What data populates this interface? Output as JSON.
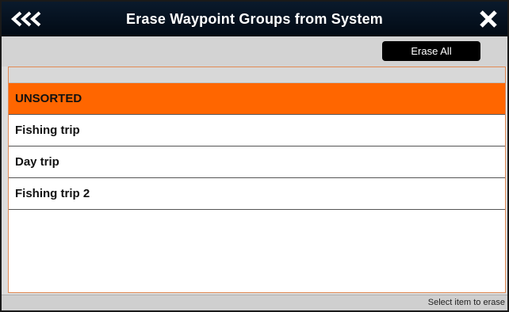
{
  "window": {
    "title": "Erase Waypoint Groups from System"
  },
  "titlebar": {
    "back_icon": "triple-chevron-left-icon",
    "close_icon": "close-icon"
  },
  "toolbar": {
    "erase_all_label": "Erase All"
  },
  "list": {
    "items": [
      {
        "label": "UNSORTED",
        "selected": true
      },
      {
        "label": "Fishing trip",
        "selected": false
      },
      {
        "label": "Day trip",
        "selected": false
      },
      {
        "label": "Fishing trip 2",
        "selected": false
      }
    ]
  },
  "status": {
    "text": "Select item to erase"
  },
  "colors": {
    "selected_row": "#ff6600",
    "titlebar": "#06121f",
    "button": "#000000"
  }
}
